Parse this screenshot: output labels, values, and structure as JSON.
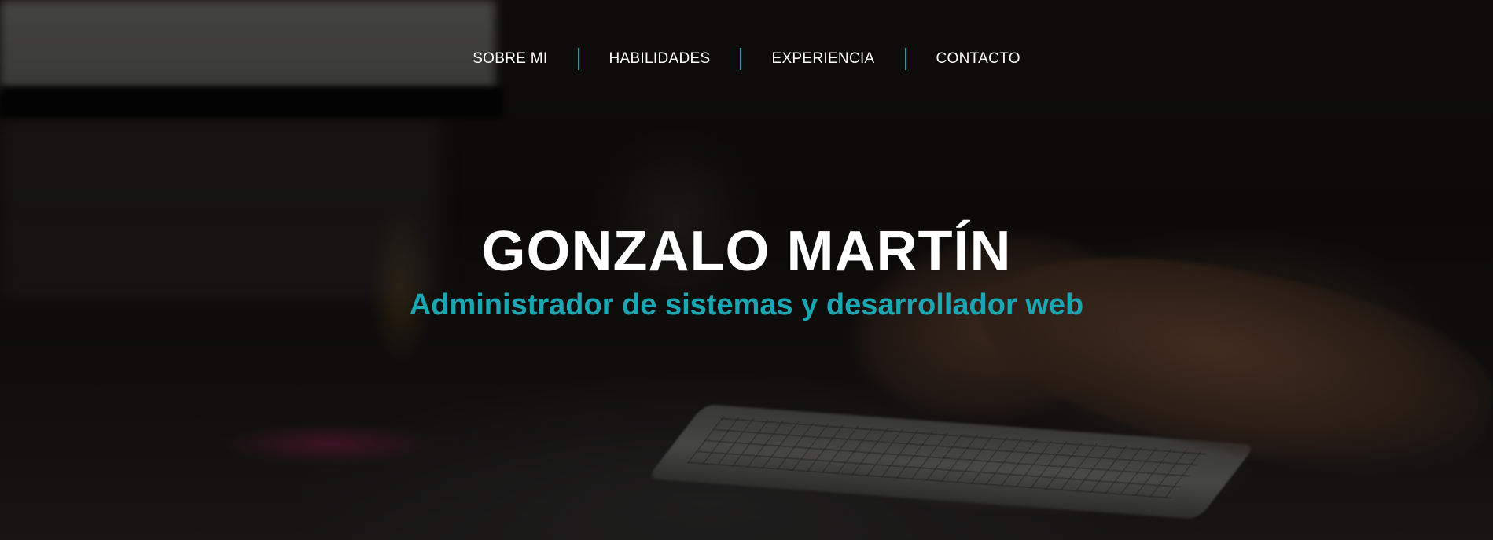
{
  "nav": {
    "items": [
      {
        "label": "SOBRE MI"
      },
      {
        "label": "HABILIDADES"
      },
      {
        "label": "EXPERIENCIA"
      },
      {
        "label": "CONTACTO"
      }
    ],
    "divider_color": "#17a6b1"
  },
  "hero": {
    "name": "GONZALO MARTÍN",
    "subtitle": "Administrador de sistemas y desarrollador web",
    "accent_color": "#1aa7b3",
    "text_color": "#ffffff"
  }
}
